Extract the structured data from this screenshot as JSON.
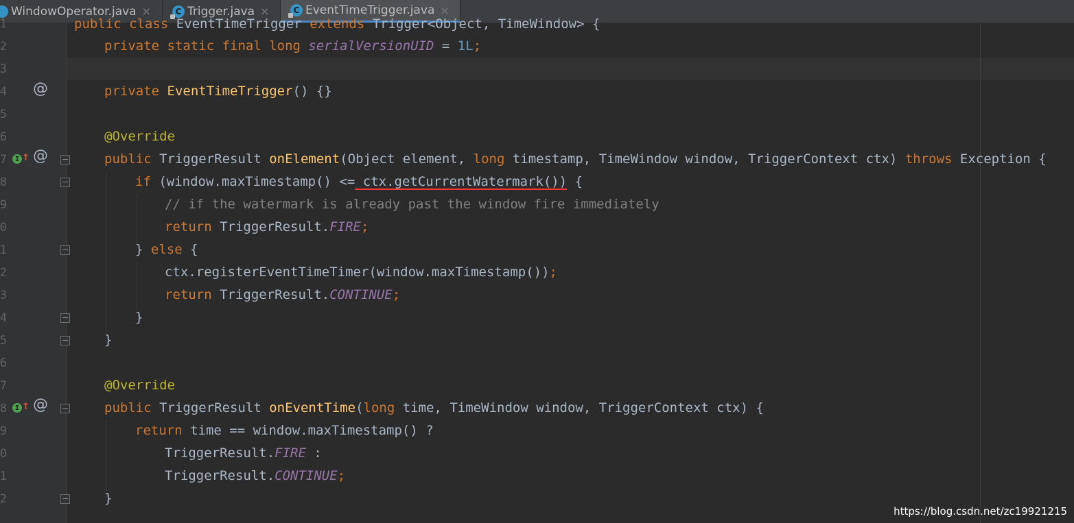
{
  "tabs": [
    {
      "label": "WindowOperator.java",
      "close": "×",
      "icon": "java-class-icon"
    },
    {
      "label": "Trigger.java",
      "close": "×",
      "icon": "java-class-icon"
    },
    {
      "label": "EventTimeTrigger.java",
      "close": "×",
      "icon": "java-class-icon",
      "active": true
    }
  ],
  "line_numbers": [
    "1",
    "2",
    "3",
    "4",
    "5",
    "6",
    "7",
    "8",
    "9",
    "0",
    "1",
    "2",
    "3",
    "4",
    "5",
    "6",
    "7",
    "8",
    "9",
    "0",
    "1",
    "2",
    ""
  ],
  "code": {
    "l1": {
      "a": "public class ",
      "b": "EventTimeTrigger ",
      "c": "extends ",
      "d": "Trigger<Object, TimeWindow> {"
    },
    "l2": {
      "a": "private static final long ",
      "b": "serialVersionUID",
      "c": " = ",
      "d": "1L",
      ";": ";"
    },
    "l4": {
      "a": "private ",
      "b": "EventTimeTrigger",
      "c": "() {}"
    },
    "l6": {
      "a": "@Override"
    },
    "l7": {
      "a": "public ",
      "b": "TriggerResult ",
      "c": "onElement",
      "d": "(Object element, ",
      "e": "long ",
      "f": "timestamp, TimeWindow window, TriggerContext ctx) ",
      "g": "throws ",
      "h": "Exception {"
    },
    "l8": {
      "a": "if ",
      "b": "(window.maxTimestamp() <=",
      "c": " ctx.getCurrentWatermark())",
      "d": " {"
    },
    "l9": {
      "a": "// if the watermark is already past the window fire immediately"
    },
    "l10": {
      "a": "return ",
      "b": "TriggerResult.",
      "c": "FIRE",
      ";": ";"
    },
    "l11": {
      "a": "} ",
      "b": "else ",
      "c": "{"
    },
    "l12": {
      "a": "ctx.registerEventTimeTimer(window.maxTimestamp())",
      ";": ";"
    },
    "l13": {
      "a": "return ",
      "b": "TriggerResult.",
      "c": "CONTINUE",
      ";": ";"
    },
    "l14": {
      "a": "}"
    },
    "l15": {
      "a": "}"
    },
    "l17": {
      "a": "@Override"
    },
    "l18": {
      "a": "public ",
      "b": "TriggerResult ",
      "c": "onEventTime",
      "d": "(",
      "e": "long ",
      "f": "time, TimeWindow window, TriggerContext ctx) {"
    },
    "l19": {
      "a": "return ",
      "b": "time == window.maxTimestamp() ?"
    },
    "l20": {
      "a": "TriggerResult.",
      "b": "FIRE",
      "c": " :"
    },
    "l21": {
      "a": "TriggerResult.",
      "b": "CONTINUE",
      ";": ";"
    },
    "l22": {
      "a": "}"
    }
  },
  "gutter": {
    "at_symbol": "@",
    "impl_letter": "I",
    "arrow": "↑"
  },
  "watermark": "https://blog.csdn.net/zc19921215",
  "colors": {
    "keyword": "#cc7832",
    "method": "#ffc66d",
    "annotation": "#bbb529",
    "constant": "#9876aa",
    "number": "#6897bb",
    "comment": "#808080",
    "text": "#a9b7c6",
    "background": "#2b2b2b"
  }
}
